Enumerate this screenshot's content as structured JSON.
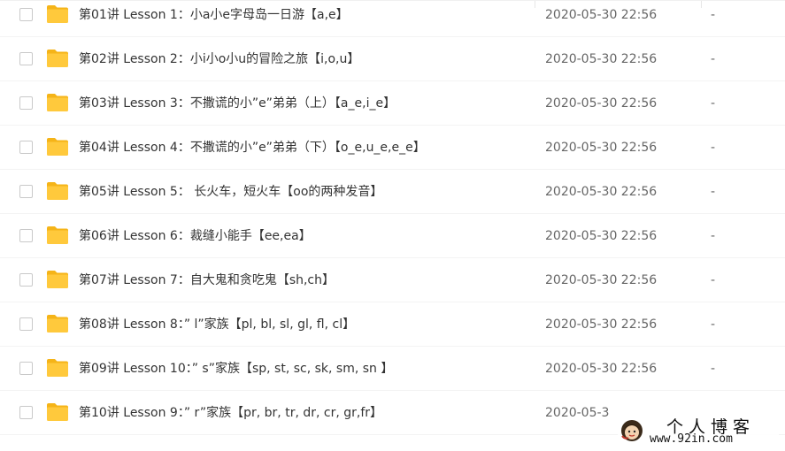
{
  "files": [
    {
      "name": "第01讲 Lesson 1：小a小e字母岛一日游【a,e】",
      "modified": "2020-05-30 22:56",
      "size": "-"
    },
    {
      "name": "第02讲 Lesson 2：小i小o小u的冒险之旅【i,o,u】",
      "modified": "2020-05-30 22:56",
      "size": "-"
    },
    {
      "name": "第03讲 Lesson 3：不撒谎的小”e”弟弟（上）【a_e,i_e】",
      "modified": "2020-05-30 22:56",
      "size": "-"
    },
    {
      "name": "第04讲 Lesson 4：不撒谎的小”e”弟弟（下）【o_e,u_e,e_e】",
      "modified": "2020-05-30 22:56",
      "size": "-"
    },
    {
      "name": "第05讲 Lesson 5： 长火车，短火车【oo的两种发音】",
      "modified": "2020-05-30 22:56",
      "size": "-"
    },
    {
      "name": "第06讲 Lesson 6：裁缝小能手【ee,ea】",
      "modified": "2020-05-30 22:56",
      "size": "-"
    },
    {
      "name": "第07讲 Lesson 7：自大鬼和贪吃鬼【sh,ch】",
      "modified": "2020-05-30 22:56",
      "size": "-"
    },
    {
      "name": "第08讲 Lesson 8：” l”家族【pl, bl, sl, gl, fl, cl】",
      "modified": "2020-05-30 22:56",
      "size": "-"
    },
    {
      "name": "第09讲 Lesson 10：” s”家族【sp, st, sc, sk, sm, sn 】",
      "modified": "2020-05-30 22:56",
      "size": "-"
    },
    {
      "name": "第10讲 Lesson 9：” r”家族【pr, br, tr, dr, cr, gr,fr】",
      "modified": "2020-05-3",
      "size": ""
    }
  ],
  "watermark": {
    "title": "个人博客",
    "url": "www.92in.com"
  },
  "colors": {
    "folder": "#FFC93C",
    "folder_tab": "#F5B418",
    "text": "#333333",
    "meta": "#666666"
  }
}
